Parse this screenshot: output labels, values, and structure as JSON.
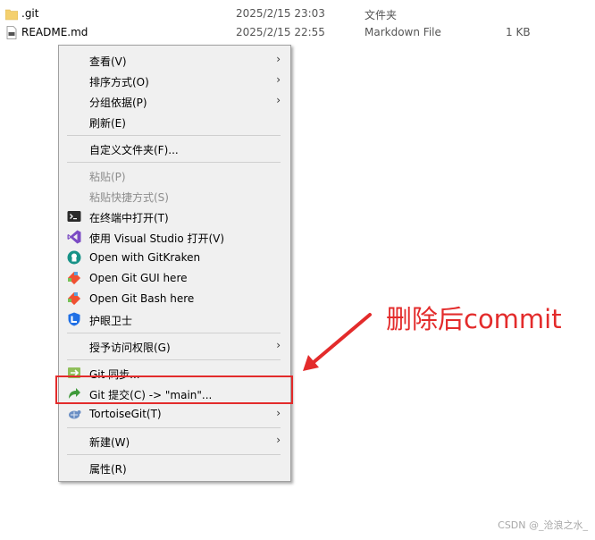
{
  "files": [
    {
      "name": ".git",
      "date": "2025/2/15 23:03",
      "type": "文件夹",
      "size": "",
      "icon": "folder-icon"
    },
    {
      "name": "README.md",
      "date": "2025/2/15 22:55",
      "type": "Markdown File",
      "size": "1 KB",
      "icon": "markdown-file-icon"
    }
  ],
  "menu": {
    "view": "查看(V)",
    "sort": "排序方式(O)",
    "group": "分组依据(P)",
    "refresh": "刷新(E)",
    "customize": "自定义文件夹(F)...",
    "paste": "粘贴(P)",
    "paste_shortcut": "粘贴快捷方式(S)",
    "open_terminal": "在终端中打开(T)",
    "open_vs": "使用 Visual Studio 打开(V)",
    "gitkraken": "Open with GitKraken",
    "git_gui": "Open Git GUI here",
    "git_bash": "Open Git Bash here",
    "guard": "护眼卫士",
    "access": "授予访问权限(G)",
    "git_sync": "Git 同步...",
    "git_commit": "Git 提交(C) -> \"main\"...",
    "tortoise": "TortoiseGit(T)",
    "new": "新建(W)",
    "properties": "属性(R)",
    "submenu_glyph": "›"
  },
  "annotation": {
    "text": "删除后commit",
    "color": "#e32b2b"
  },
  "watermark": "CSDN @_沧浪之水_"
}
